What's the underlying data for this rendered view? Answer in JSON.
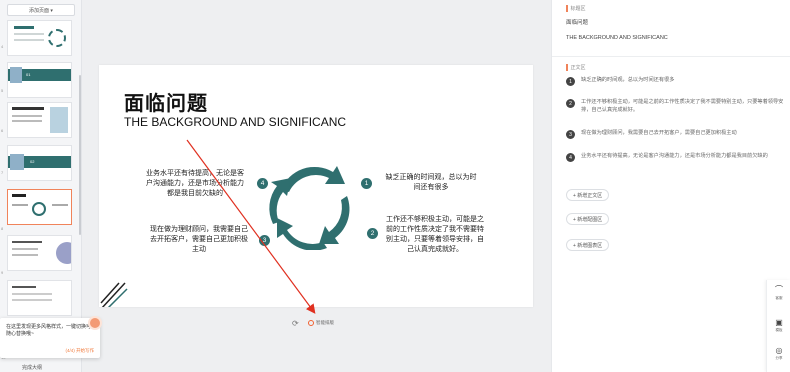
{
  "left_panel": {
    "add_plan_label": "添加页面 ▾",
    "thumbnail_numbers": [
      "4",
      "5",
      "6",
      "7",
      "8",
      "9",
      "10"
    ],
    "thumb_section_nums": [
      "01",
      "02"
    ]
  },
  "tooltip": {
    "text": "在这里发现更多风格样式，一键切换可随心替换哦~",
    "progress": "(4/4) 开始写作"
  },
  "bottom": {
    "mode_label": "完成大纲"
  },
  "slide": {
    "title": "面临问题",
    "subtitle": "THE BACKGROUND AND SIGNIFICANC",
    "point1": "缺乏正确的时间观，总以为时间还有很多",
    "point2": "工作还不够积极主动，可能是之前的工作性质决定了我不需要特别主动，只要等着领导安排，自己认真完成就好。",
    "point3": "现在做为理财顾问，我需要自己去开拓客户，需要自己更加积极主动",
    "point4": "业务水平还有待提高，无论是客户沟通能力，还是市场分析能力都是我目前欠缺的",
    "nums": [
      "1",
      "2",
      "3",
      "4"
    ],
    "accent_color": "#2f6f6f"
  },
  "controls": {
    "smart_label": "智能排版"
  },
  "right_panel": {
    "title_section_label": "标题区",
    "title_value": "面临问题",
    "subtitle_value": "THE BACKGROUND AND SIGNIFICANC",
    "body_section_label": "正文区",
    "items": [
      {
        "num": "1",
        "text": "缺乏正确的时间观，总以为时间还有很多"
      },
      {
        "num": "2",
        "text": "工作还不够积极主动，可能是之前的工作性质决定了我不需要特别主动，只要等着领导安排，自己认真完成就好。"
      },
      {
        "num": "3",
        "text": "现在做为理财顾问，我需要自己去开拓客户，需要自己更加积极主动"
      },
      {
        "num": "4",
        "text": "业务水平还有待提高，无论是客户沟通能力，还是市场分析能力都是我目前欠缺的"
      }
    ],
    "add_body_label": "+ 新增正文区",
    "add_image_label": "+ 新增配图区",
    "add_chart_label": "+ 新增图表区"
  },
  "tools": [
    {
      "icon": "headset-icon",
      "label": "客服"
    },
    {
      "icon": "template-icon",
      "label": "模板"
    },
    {
      "icon": "share-icon",
      "label": "分享"
    }
  ]
}
